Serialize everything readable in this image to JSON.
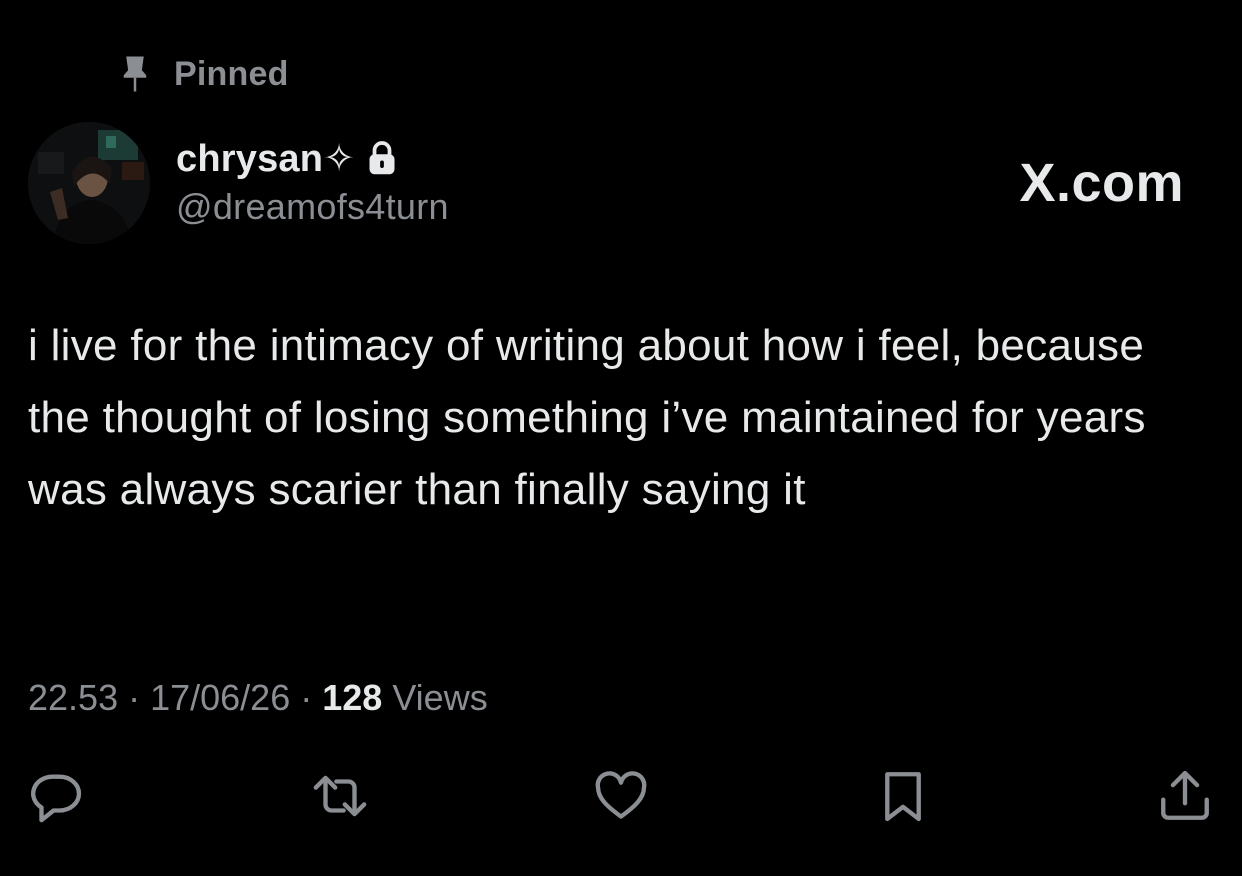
{
  "pinned": {
    "label": "Pinned",
    "icon": "pin-icon"
  },
  "author": {
    "display_name": "chrysan✧",
    "handle": "@dreamofs4turn",
    "lock_icon": "lock-icon",
    "avatar_icon": "avatar"
  },
  "brand": {
    "label": "X.com"
  },
  "tweet": {
    "text": "i live for the intimacy of writing about how i feel, because the thought of losing something i’ve maintained for years was always scarier than finally saying it"
  },
  "meta": {
    "time": "22.53",
    "separator": " · ",
    "date": "17/06/26",
    "views_count": "128",
    "views_label": " Views"
  },
  "actions": [
    {
      "name": "reply",
      "icon": "reply-icon"
    },
    {
      "name": "repost",
      "icon": "repost-icon"
    },
    {
      "name": "like",
      "icon": "heart-icon"
    },
    {
      "name": "bookmark",
      "icon": "bookmark-icon"
    },
    {
      "name": "share",
      "icon": "share-icon"
    }
  ],
  "colors": {
    "background": "#000000",
    "primary_text": "#e7e9ea",
    "secondary_text": "#8b8e93"
  }
}
